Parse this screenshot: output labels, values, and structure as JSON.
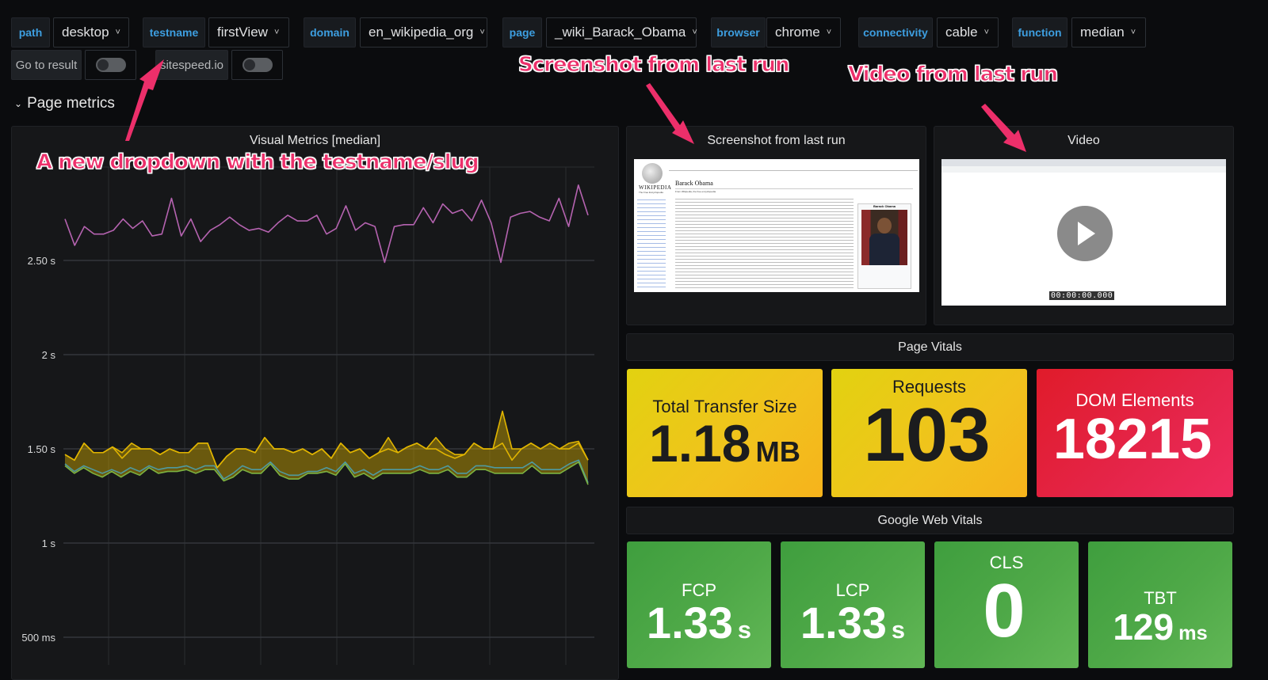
{
  "variables": [
    {
      "label": "path",
      "value": "desktop"
    },
    {
      "label": "testname",
      "value": "firstView"
    },
    {
      "label": "domain",
      "value": "en_wikipedia_org"
    },
    {
      "label": "page",
      "value": "_wiki_Barack_Obama"
    },
    {
      "label": "browser",
      "value": "chrome"
    },
    {
      "label": "connectivity",
      "value": "cable"
    },
    {
      "label": "function",
      "value": "median"
    }
  ],
  "links": [
    {
      "label": "Go to result",
      "toggle_on": false
    },
    {
      "label": "sitespeed.io",
      "toggle_on": false
    }
  ],
  "row": {
    "title": "Page metrics",
    "icon": "chevron-down-icon"
  },
  "annotations": {
    "testname": "A new dropdown with the testname/slug",
    "screenshot": "Screenshot from last run",
    "video": "Video from last run"
  },
  "screenshot_panel": {
    "title": "Screenshot from last run",
    "wiki": {
      "logo_text": "WIKIPEDIA",
      "logo_sub": "The Free Encyclopedia",
      "article_title": "Barack Obama",
      "from_line": "From Wikipedia, the free encyclopedia",
      "infobox_title": "Barack Obama"
    }
  },
  "video_panel": {
    "title": "Video",
    "timestamp": "00:00:00.000"
  },
  "page_vitals": {
    "title": "Page Vitals",
    "stats": [
      {
        "label": "Total Transfer Size",
        "value": "1.18",
        "unit": "MB",
        "color": "yellow"
      },
      {
        "label": "Requests",
        "value": "103",
        "unit": "",
        "color": "yellow"
      },
      {
        "label": "DOM Elements",
        "value": "18215",
        "unit": "",
        "color": "red"
      }
    ]
  },
  "web_vitals": {
    "title": "Google Web Vitals",
    "stats": [
      {
        "label": "FCP",
        "value": "1.33",
        "unit": "s",
        "color": "green"
      },
      {
        "label": "LCP",
        "value": "1.33",
        "unit": "s",
        "color": "green"
      },
      {
        "label": "CLS",
        "value": "0",
        "unit": "",
        "color": "green"
      },
      {
        "label": "TBT",
        "value": "129",
        "unit": "ms",
        "color": "green"
      }
    ]
  },
  "colors": {
    "accent_label": "#3d9ee0",
    "annotation": "#ec2f6a",
    "series_magenta": "#b563b0",
    "series_orange": "#e0b400",
    "series_teal": "#4f9aa0",
    "series_green": "#7cb342"
  },
  "chart_data": {
    "type": "line",
    "title": "Visual Metrics [median]",
    "xlabel": "",
    "ylabel": "",
    "ylim": [
      0.42,
      3.0
    ],
    "y_ticks": [
      {
        "value": 0.5,
        "label": "500 ms"
      },
      {
        "value": 1.0,
        "label": "1 s"
      },
      {
        "value": 1.5,
        "label": "1.50 s"
      },
      {
        "value": 2.0,
        "label": "2 s"
      },
      {
        "value": 2.5,
        "label": "2.50 s"
      }
    ],
    "grid": true,
    "legend": "none",
    "series": [
      {
        "name": "series-magenta",
        "color": "#b563b0",
        "fill": false,
        "values": [
          2.72,
          2.58,
          2.68,
          2.64,
          2.64,
          2.66,
          2.72,
          2.67,
          2.71,
          2.63,
          2.64,
          2.83,
          2.63,
          2.72,
          2.6,
          2.66,
          2.69,
          2.73,
          2.69,
          2.66,
          2.67,
          2.65,
          2.7,
          2.74,
          2.71,
          2.71,
          2.74,
          2.64,
          2.67,
          2.79,
          2.66,
          2.7,
          2.68,
          2.49,
          2.68,
          2.69,
          2.69,
          2.78,
          2.7,
          2.8,
          2.75,
          2.77,
          2.71,
          2.82,
          2.7,
          2.49,
          2.73,
          2.75,
          2.76,
          2.73,
          2.71,
          2.83,
          2.68,
          2.9,
          2.74
        ]
      },
      {
        "name": "series-orange-upper",
        "color": "#e0b400",
        "fill": true,
        "values": [
          1.47,
          1.44,
          1.53,
          1.48,
          1.48,
          1.51,
          1.48,
          1.53,
          1.5,
          1.5,
          1.47,
          1.5,
          1.48,
          1.48,
          1.53,
          1.53,
          1.4,
          1.46,
          1.5,
          1.5,
          1.48,
          1.56,
          1.5,
          1.5,
          1.48,
          1.5,
          1.47,
          1.5,
          1.45,
          1.53,
          1.48,
          1.5,
          1.45,
          1.48,
          1.56,
          1.48,
          1.51,
          1.53,
          1.5,
          1.56,
          1.5,
          1.47,
          1.47,
          1.53,
          1.5,
          1.5,
          1.7,
          1.5,
          1.5,
          1.53,
          1.5,
          1.53,
          1.5,
          1.53,
          1.54,
          1.44
        ]
      },
      {
        "name": "series-orange-lower",
        "color": "#e0b400",
        "fill": false,
        "values": [
          1.47,
          1.44,
          1.53,
          1.48,
          1.48,
          1.51,
          1.45,
          1.5,
          1.5,
          1.5,
          1.47,
          1.5,
          1.48,
          1.48,
          1.53,
          1.53,
          1.4,
          1.46,
          1.5,
          1.5,
          1.48,
          1.56,
          1.5,
          1.5,
          1.48,
          1.5,
          1.47,
          1.5,
          1.45,
          1.53,
          1.48,
          1.5,
          1.45,
          1.48,
          1.5,
          1.48,
          1.51,
          1.53,
          1.5,
          1.5,
          1.47,
          1.45,
          1.47,
          1.53,
          1.5,
          1.5,
          1.53,
          1.44,
          1.5,
          1.53,
          1.5,
          1.53,
          1.5,
          1.5,
          1.53,
          1.44
        ]
      },
      {
        "name": "series-teal",
        "color": "#4f9aa0",
        "fill": false,
        "values": [
          1.42,
          1.38,
          1.41,
          1.39,
          1.37,
          1.39,
          1.37,
          1.4,
          1.38,
          1.41,
          1.39,
          1.4,
          1.4,
          1.41,
          1.39,
          1.41,
          1.41,
          1.34,
          1.37,
          1.41,
          1.39,
          1.39,
          1.43,
          1.38,
          1.36,
          1.36,
          1.38,
          1.38,
          1.4,
          1.38,
          1.43,
          1.37,
          1.39,
          1.36,
          1.39,
          1.39,
          1.39,
          1.39,
          1.41,
          1.39,
          1.39,
          1.41,
          1.37,
          1.37,
          1.41,
          1.41,
          1.4,
          1.4,
          1.4,
          1.4,
          1.43,
          1.39,
          1.39,
          1.39,
          1.42,
          1.44,
          1.32
        ]
      },
      {
        "name": "series-green",
        "color": "#7cb342",
        "fill": false,
        "values": [
          1.41,
          1.37,
          1.4,
          1.37,
          1.35,
          1.38,
          1.35,
          1.38,
          1.36,
          1.4,
          1.37,
          1.38,
          1.38,
          1.39,
          1.37,
          1.39,
          1.39,
          1.33,
          1.35,
          1.39,
          1.37,
          1.37,
          1.42,
          1.36,
          1.34,
          1.34,
          1.37,
          1.37,
          1.38,
          1.36,
          1.42,
          1.35,
          1.37,
          1.34,
          1.37,
          1.37,
          1.37,
          1.37,
          1.39,
          1.37,
          1.37,
          1.39,
          1.35,
          1.35,
          1.39,
          1.39,
          1.37,
          1.37,
          1.37,
          1.37,
          1.41,
          1.37,
          1.37,
          1.37,
          1.4,
          1.43,
          1.31
        ]
      }
    ]
  }
}
